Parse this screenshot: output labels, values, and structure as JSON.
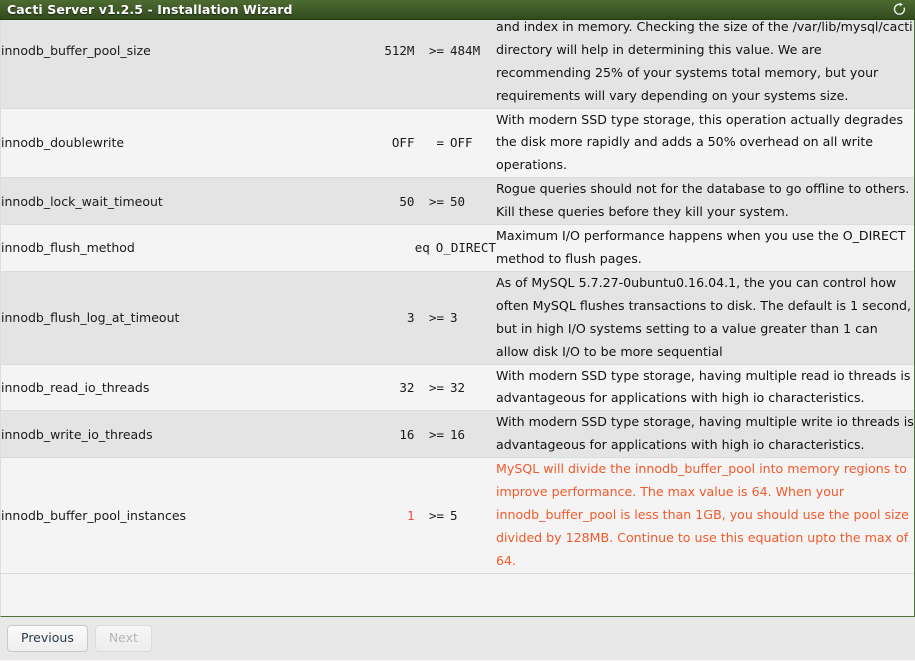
{
  "window": {
    "title": "Cacti Server v1.2.5 - Installation Wizard",
    "refresh_icon": "refresh-icon"
  },
  "colors": {
    "titlebar_green": "#415c29",
    "border_green": "#52703a",
    "warning_red": "#f15a2c",
    "row_odd": "#e4e4e4",
    "row_even": "#f4f4f4",
    "page_bg": "#fdf7f7"
  },
  "checks": [
    {
      "name": "innodb_buffer_pool_size",
      "current": "512M",
      "operator": ">=",
      "expected": "484M",
      "status": "ok",
      "description": "innodb_buffer_pool large enough to hold as much of the tables and index in memory. Checking the size of the /var/lib/mysql/cacti directory will help in determining this value. We are recommending 25% of your systems total memory, but your requirements will vary depending on your systems size."
    },
    {
      "name": "innodb_doublewrite",
      "current": "OFF",
      "operator": "=",
      "expected": "OFF",
      "status": "ok",
      "description": "With modern SSD type storage, this operation actually degrades the disk more rapidly and adds a 50% overhead on all write operations."
    },
    {
      "name": "innodb_lock_wait_timeout",
      "current": "50",
      "operator": ">=",
      "expected": "50",
      "status": "ok",
      "description": "Rogue queries should not for the database to go offline to others. Kill these queries before they kill your system."
    },
    {
      "name": "innodb_flush_method",
      "current": "",
      "operator": "eq",
      "expected": "O_DIRECT",
      "status": "ok",
      "description": "Maximum I/O performance happens when you use the O_DIRECT method to flush pages."
    },
    {
      "name": "innodb_flush_log_at_timeout",
      "current": "3",
      "operator": ">=",
      "expected": "3",
      "status": "ok",
      "description": "As of MySQL 5.7.27-0ubuntu0.16.04.1, the you can control how often MySQL flushes transactions to disk. The default is 1 second, but in high I/O systems setting to a value greater than 1 can allow disk I/O to be more sequential"
    },
    {
      "name": "innodb_read_io_threads",
      "current": "32",
      "operator": ">=",
      "expected": "32",
      "status": "ok",
      "description": "With modern SSD type storage, having multiple read io threads is advantageous for applications with high io characteristics."
    },
    {
      "name": "innodb_write_io_threads",
      "current": "16",
      "operator": ">=",
      "expected": "16",
      "status": "ok",
      "description": "With modern SSD type storage, having multiple write io threads is advantageous for applications with high io characteristics."
    },
    {
      "name": "innodb_buffer_pool_instances",
      "current": "1",
      "operator": ">=",
      "expected": "5",
      "status": "warn",
      "description": "MySQL will divide the innodb_buffer_pool into memory regions to improve performance. The max value is 64. When your innodb_buffer_pool is less than 1GB, you should use the pool size divided by 128MB. Continue to use this equation upto the max of 64."
    }
  ],
  "footer": {
    "previous_label": "Previous",
    "next_label": "Next",
    "next_disabled": true
  }
}
